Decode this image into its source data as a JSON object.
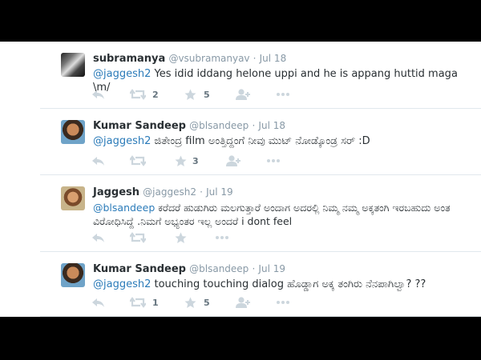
{
  "tweets": [
    {
      "fullname": "subramanya",
      "username": "@vsubramanyav",
      "dot": "·",
      "time": "Jul 18",
      "mention": "@jaggesh2",
      "text": " Yes idid iddang helone uppi and he is appang huttid maga \\m/",
      "retweets": "2",
      "favorites": "5"
    },
    {
      "fullname": "Kumar Sandeep",
      "username": "@blsandeep",
      "dot": "·",
      "time": "Jul 18",
      "mention": "@jaggesh2",
      "text": " ಜಿತೇಂದ್ರ film ಅಂತ್ತಿದ್ದಂಗೆ ನೀವು ಮುಟ್ ನೋಡ್ಕೊಂಡ್ರ ಸರ್ :D",
      "retweets": "",
      "favorites": "3"
    },
    {
      "fullname": "Jaggesh",
      "username": "@jaggesh2",
      "dot": "·",
      "time": "Jul 19",
      "mention": "@blsandeep",
      "text": "  ಕರೆದರೆ ಹುಡುಗಿರು ಮಲಗುತ್ತಾರೆ ಅಂದಾಗ ಅದರಲ್ಲಿ ನಿಮ್ಮ ನಮ್ಮ ಅಕ್ಕತಂಗಿ ಇರಬಹುದು ಅಂತ ವಿರೋಧಿಸಿದ್ದೆ .ನಿಮಗೆ ಅಭ್ಯಂತರ ಇಲ್ಲ ಅಂದರೆ i dont feel",
      "retweets": "",
      "favorites": ""
    },
    {
      "fullname": "Kumar Sandeep",
      "username": "@blsandeep",
      "dot": "·",
      "time": "Jul 19",
      "mention": "@jaggesh2",
      "text": " touching touching dialog ಹೊಡ್ಡಾಗ ಅಕ್ಕ ತಂಗಿರು ನೆನಪಾಗಿಲ್ವಾ? ??",
      "retweets": "1",
      "favorites": "5"
    }
  ],
  "icons": {
    "reply": "reply-icon",
    "retweet": "retweet-icon",
    "favorite": "star-icon",
    "follow": "follow-icon",
    "more": "more-icon"
  },
  "colors": {
    "background": "#000000",
    "panel": "#ffffff",
    "text": "#292f33",
    "muted": "#8899a6",
    "link": "#2b7bb9",
    "icon": "#ccd6dd"
  }
}
